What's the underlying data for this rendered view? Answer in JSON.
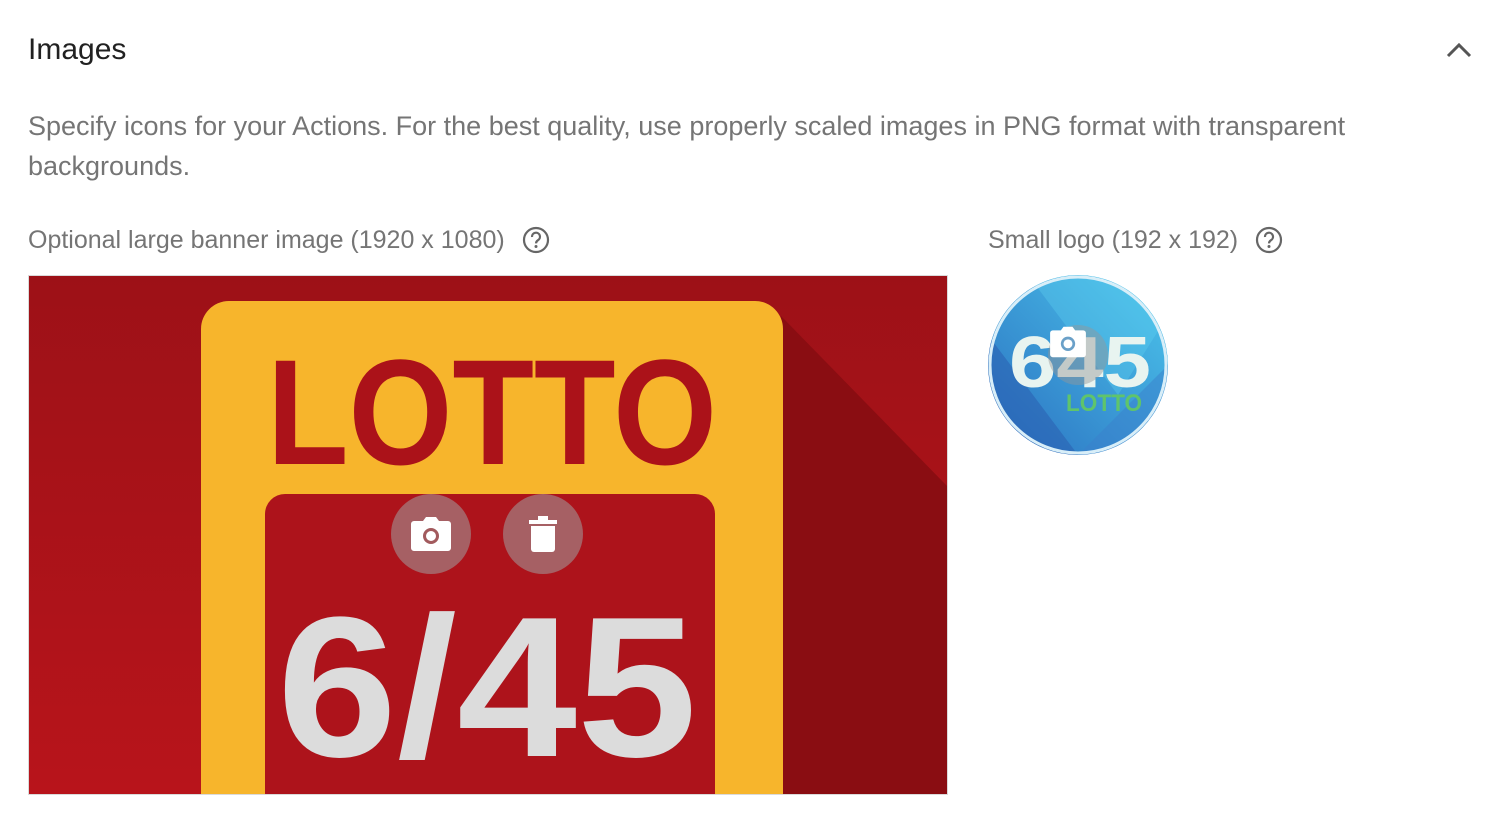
{
  "section": {
    "title": "Images",
    "description": "Specify icons for your Actions. For the best quality, use properly scaled images in PNG format with transparent backgrounds."
  },
  "banner": {
    "label": "Optional large banner image (1920 x 1080)",
    "image_text_top": "LOTTO",
    "image_text_bottom": "6/45",
    "colors": {
      "background": "#a3121a",
      "frame": "#f7b52c",
      "inner": "#b0141c",
      "digits": "#dcdcdc"
    }
  },
  "logo": {
    "label": "Small logo (192 x 192)",
    "image_text_number": "645",
    "image_text_word": "LOTTO",
    "colors": {
      "primary": "#2a9bd8",
      "light": "#4cc6ec",
      "accent": "#5fc46b"
    }
  },
  "icons": {
    "collapse": "chevron-up-icon",
    "help": "help-circle-icon",
    "camera": "camera-icon",
    "delete": "trash-icon"
  }
}
